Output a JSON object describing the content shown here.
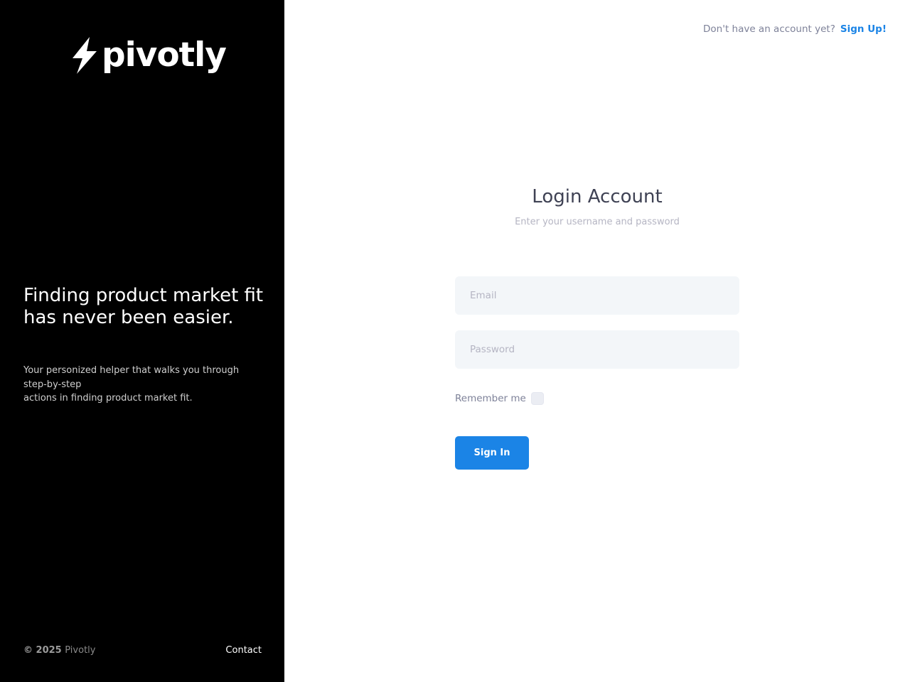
{
  "brand": {
    "logo_text": "pivotly",
    "logo_icon": "lightning-bolt-icon"
  },
  "aside": {
    "tagline_lines": [
      "Finding product market fit",
      "has never been easier."
    ],
    "subtext_lines": [
      "Your personized helper that walks you through step-by-step",
      "actions in finding product market fit."
    ],
    "copyright": "© 2025",
    "copyright_brand": "Pivotly",
    "contact_label": "Contact"
  },
  "topnav": {
    "prompt": "Don't have an account yet?",
    "signup_label": "Sign Up!"
  },
  "form": {
    "title": "Login Account",
    "subtitle": "Enter your username and password",
    "email_placeholder": "Email",
    "email_value": "",
    "password_placeholder": "Password",
    "password_value": "",
    "remember_label": "Remember me",
    "remember_checked": false,
    "submit_label": "Sign In"
  },
  "colors": {
    "aside_bg": "#000000",
    "accent": "#1b84e6",
    "input_bg": "#f3f6f9",
    "heading": "#3f4254"
  }
}
